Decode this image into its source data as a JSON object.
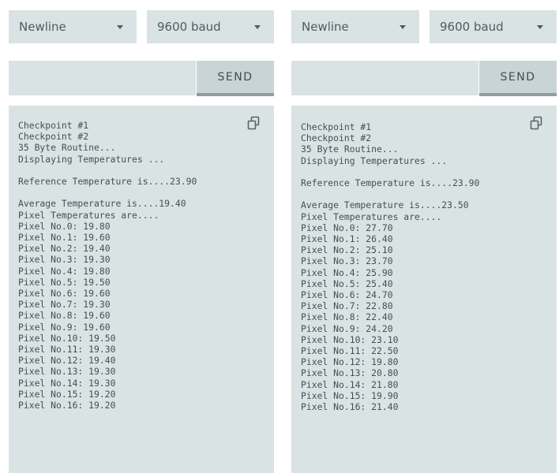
{
  "left_panel": {
    "line_ending": "Newline",
    "baud_rate": "9600 baud",
    "input_value": "",
    "send_label": "SEND",
    "output_lines": [
      "Checkpoint #1",
      "Checkpoint #2",
      "35 Byte Routine...",
      "Displaying Temperatures ...",
      "",
      "Reference Temperature is....23.90",
      "",
      "Average Temperature is....19.40",
      "Pixel Temperatures are....",
      "Pixel No.0: 19.80",
      "Pixel No.1: 19.60",
      "Pixel No.2: 19.40",
      "Pixel No.3: 19.30",
      "Pixel No.4: 19.80",
      "Pixel No.5: 19.50",
      "Pixel No.6: 19.60",
      "Pixel No.7: 19.30",
      "Pixel No.8: 19.60",
      "Pixel No.9: 19.60",
      "Pixel No.10: 19.50",
      "Pixel No.11: 19.30",
      "Pixel No.12: 19.40",
      "Pixel No.13: 19.30",
      "Pixel No.14: 19.30",
      "Pixel No.15: 19.20",
      "Pixel No.16: 19.20"
    ]
  },
  "right_panel": {
    "line_ending": "Newline",
    "baud_rate": "9600 baud",
    "input_value": "",
    "send_label": "SEND",
    "output_lines": [
      "Checkpoint #1",
      "Checkpoint #2",
      "35 Byte Routine...",
      "Displaying Temperatures ...",
      "",
      "Reference Temperature is....23.90",
      "",
      "Average Temperature is....23.50",
      "Pixel Temperatures are....",
      "Pixel No.0: 27.70",
      "Pixel No.1: 26.40",
      "Pixel No.2: 25.10",
      "Pixel No.3: 23.70",
      "Pixel No.4: 25.90",
      "Pixel No.5: 25.40",
      "Pixel No.6: 24.70",
      "Pixel No.7: 22.80",
      "Pixel No.8: 22.40",
      "Pixel No.9: 24.20",
      "Pixel No.10: 23.10",
      "Pixel No.11: 22.50",
      "Pixel No.12: 19.80",
      "Pixel No.13: 20.80",
      "Pixel No.14: 21.80",
      "Pixel No.15: 19.90",
      "Pixel No.16: 21.40"
    ]
  },
  "icons": {
    "dropdown": "chevron-down-icon",
    "copy": "copy-icon"
  },
  "colors": {
    "panel_background": "#dae3e3",
    "button_background": "#c9d4d6",
    "button_underline": "#8c9ea3",
    "text": "#434f57"
  }
}
